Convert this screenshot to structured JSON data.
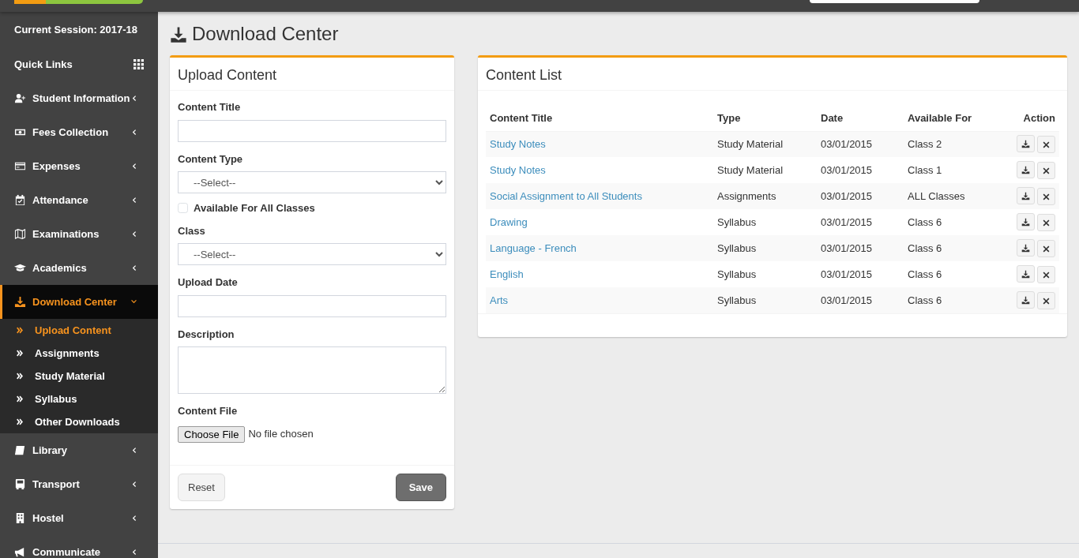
{
  "sidebar": {
    "session": "Current Session: 2017-18",
    "quick_links": "Quick Links",
    "menu": [
      {
        "label": "Student Information",
        "selected": false,
        "expanded": false
      },
      {
        "label": "Fees Collection",
        "selected": false,
        "expanded": false
      },
      {
        "label": "Expenses",
        "selected": false,
        "expanded": false
      },
      {
        "label": "Attendance",
        "selected": false,
        "expanded": false
      },
      {
        "label": "Examinations",
        "selected": false,
        "expanded": false
      },
      {
        "label": "Academics",
        "selected": false,
        "expanded": false
      },
      {
        "label": "Download Center",
        "selected": true,
        "expanded": true,
        "children": [
          {
            "label": "Upload Content",
            "selected": true
          },
          {
            "label": "Assignments",
            "selected": false
          },
          {
            "label": "Study Material",
            "selected": false
          },
          {
            "label": "Syllabus",
            "selected": false
          },
          {
            "label": "Other Downloads",
            "selected": false
          }
        ]
      },
      {
        "label": "Library",
        "selected": false,
        "expanded": false
      },
      {
        "label": "Transport",
        "selected": false,
        "expanded": false
      },
      {
        "label": "Hostel",
        "selected": false,
        "expanded": false
      },
      {
        "label": "Communicate",
        "selected": false,
        "expanded": false
      }
    ]
  },
  "page_title": "Download Center",
  "upload_form": {
    "title": "Upload Content",
    "fields": [
      {
        "kind": "text",
        "label": "Content Title"
      },
      {
        "kind": "select",
        "label": "Content Type",
        "value": "--Select--"
      },
      {
        "kind": "checkbox",
        "label": "Available For All Classes",
        "checked": false
      },
      {
        "kind": "select",
        "label": "Class",
        "value": "--Select--"
      },
      {
        "kind": "text",
        "label": "Upload Date"
      },
      {
        "kind": "textarea",
        "label": "Description"
      },
      {
        "kind": "file",
        "label": "Content File",
        "button": "Choose File",
        "status": "No file chosen"
      }
    ],
    "buttons": [
      {
        "label": "Reset",
        "kind": "default"
      },
      {
        "label": "Save",
        "kind": "primary"
      }
    ]
  },
  "content_list": {
    "title": "Content List",
    "columns": [
      "Content Title",
      "Type",
      "Date",
      "Available For",
      "Action"
    ],
    "rows": [
      {
        "title": "Study Notes",
        "type": "Study Material",
        "date": "03/01/2015",
        "available_for": "Class 2"
      },
      {
        "title": "Study Notes",
        "type": "Study Material",
        "date": "03/01/2015",
        "available_for": "Class 1"
      },
      {
        "title": "Social Assignment to All Students",
        "type": "Assignments",
        "date": "03/01/2015",
        "available_for": "ALL Classes"
      },
      {
        "title": "Drawing",
        "type": "Syllabus",
        "date": "03/01/2015",
        "available_for": "Class 6"
      },
      {
        "title": "Language - French",
        "type": "Syllabus",
        "date": "03/01/2015",
        "available_for": "Class 6"
      },
      {
        "title": "English",
        "type": "Syllabus",
        "date": "03/01/2015",
        "available_for": "Class 6"
      },
      {
        "title": "Arts",
        "type": "Syllabus",
        "date": "03/01/2015",
        "available_for": "Class 6"
      }
    ]
  }
}
